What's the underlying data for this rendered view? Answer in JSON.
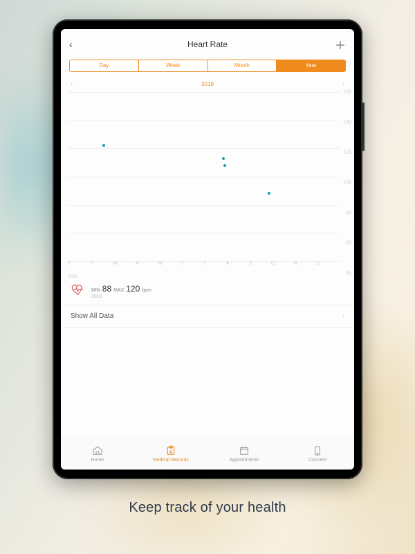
{
  "header": {
    "title": "Heart Rate"
  },
  "segments": {
    "items": [
      "Day",
      "Week",
      "Month",
      "Year"
    ],
    "active_index": 3
  },
  "period": {
    "label": "2019"
  },
  "chart_data": {
    "type": "scatter",
    "xlabel": "",
    "ylabel": "",
    "ylim": [
      40,
      160
    ],
    "y_ticks": [
      40,
      60,
      80,
      100,
      120,
      140,
      160
    ],
    "categories": [
      "J",
      "F",
      "M",
      "A",
      "M",
      "J",
      "J",
      "A",
      "S",
      "O",
      "N",
      "D"
    ],
    "x_footer": "2019",
    "series": [
      {
        "name": "Heart Rate",
        "points": [
          {
            "x_index": 1.6,
            "y": 122
          },
          {
            "x_index": 6.9,
            "y": 113
          },
          {
            "x_index": 6.95,
            "y": 108
          },
          {
            "x_index": 8.9,
            "y": 88
          }
        ]
      }
    ]
  },
  "summary": {
    "min_label": "MIN",
    "min_value": "88",
    "max_label": "MAX",
    "max_value": "120",
    "unit": "bpm",
    "sub": "2019"
  },
  "show_all": {
    "label": "Show All Data"
  },
  "tabs": {
    "active_index": 1,
    "items": [
      {
        "label": "Home"
      },
      {
        "label": "Medical Records"
      },
      {
        "label": "Appointments"
      },
      {
        "label": "Connect"
      }
    ]
  },
  "caption": "Keep track of your health",
  "colors": {
    "accent": "#f08b1d",
    "data": "#17a2a8"
  }
}
